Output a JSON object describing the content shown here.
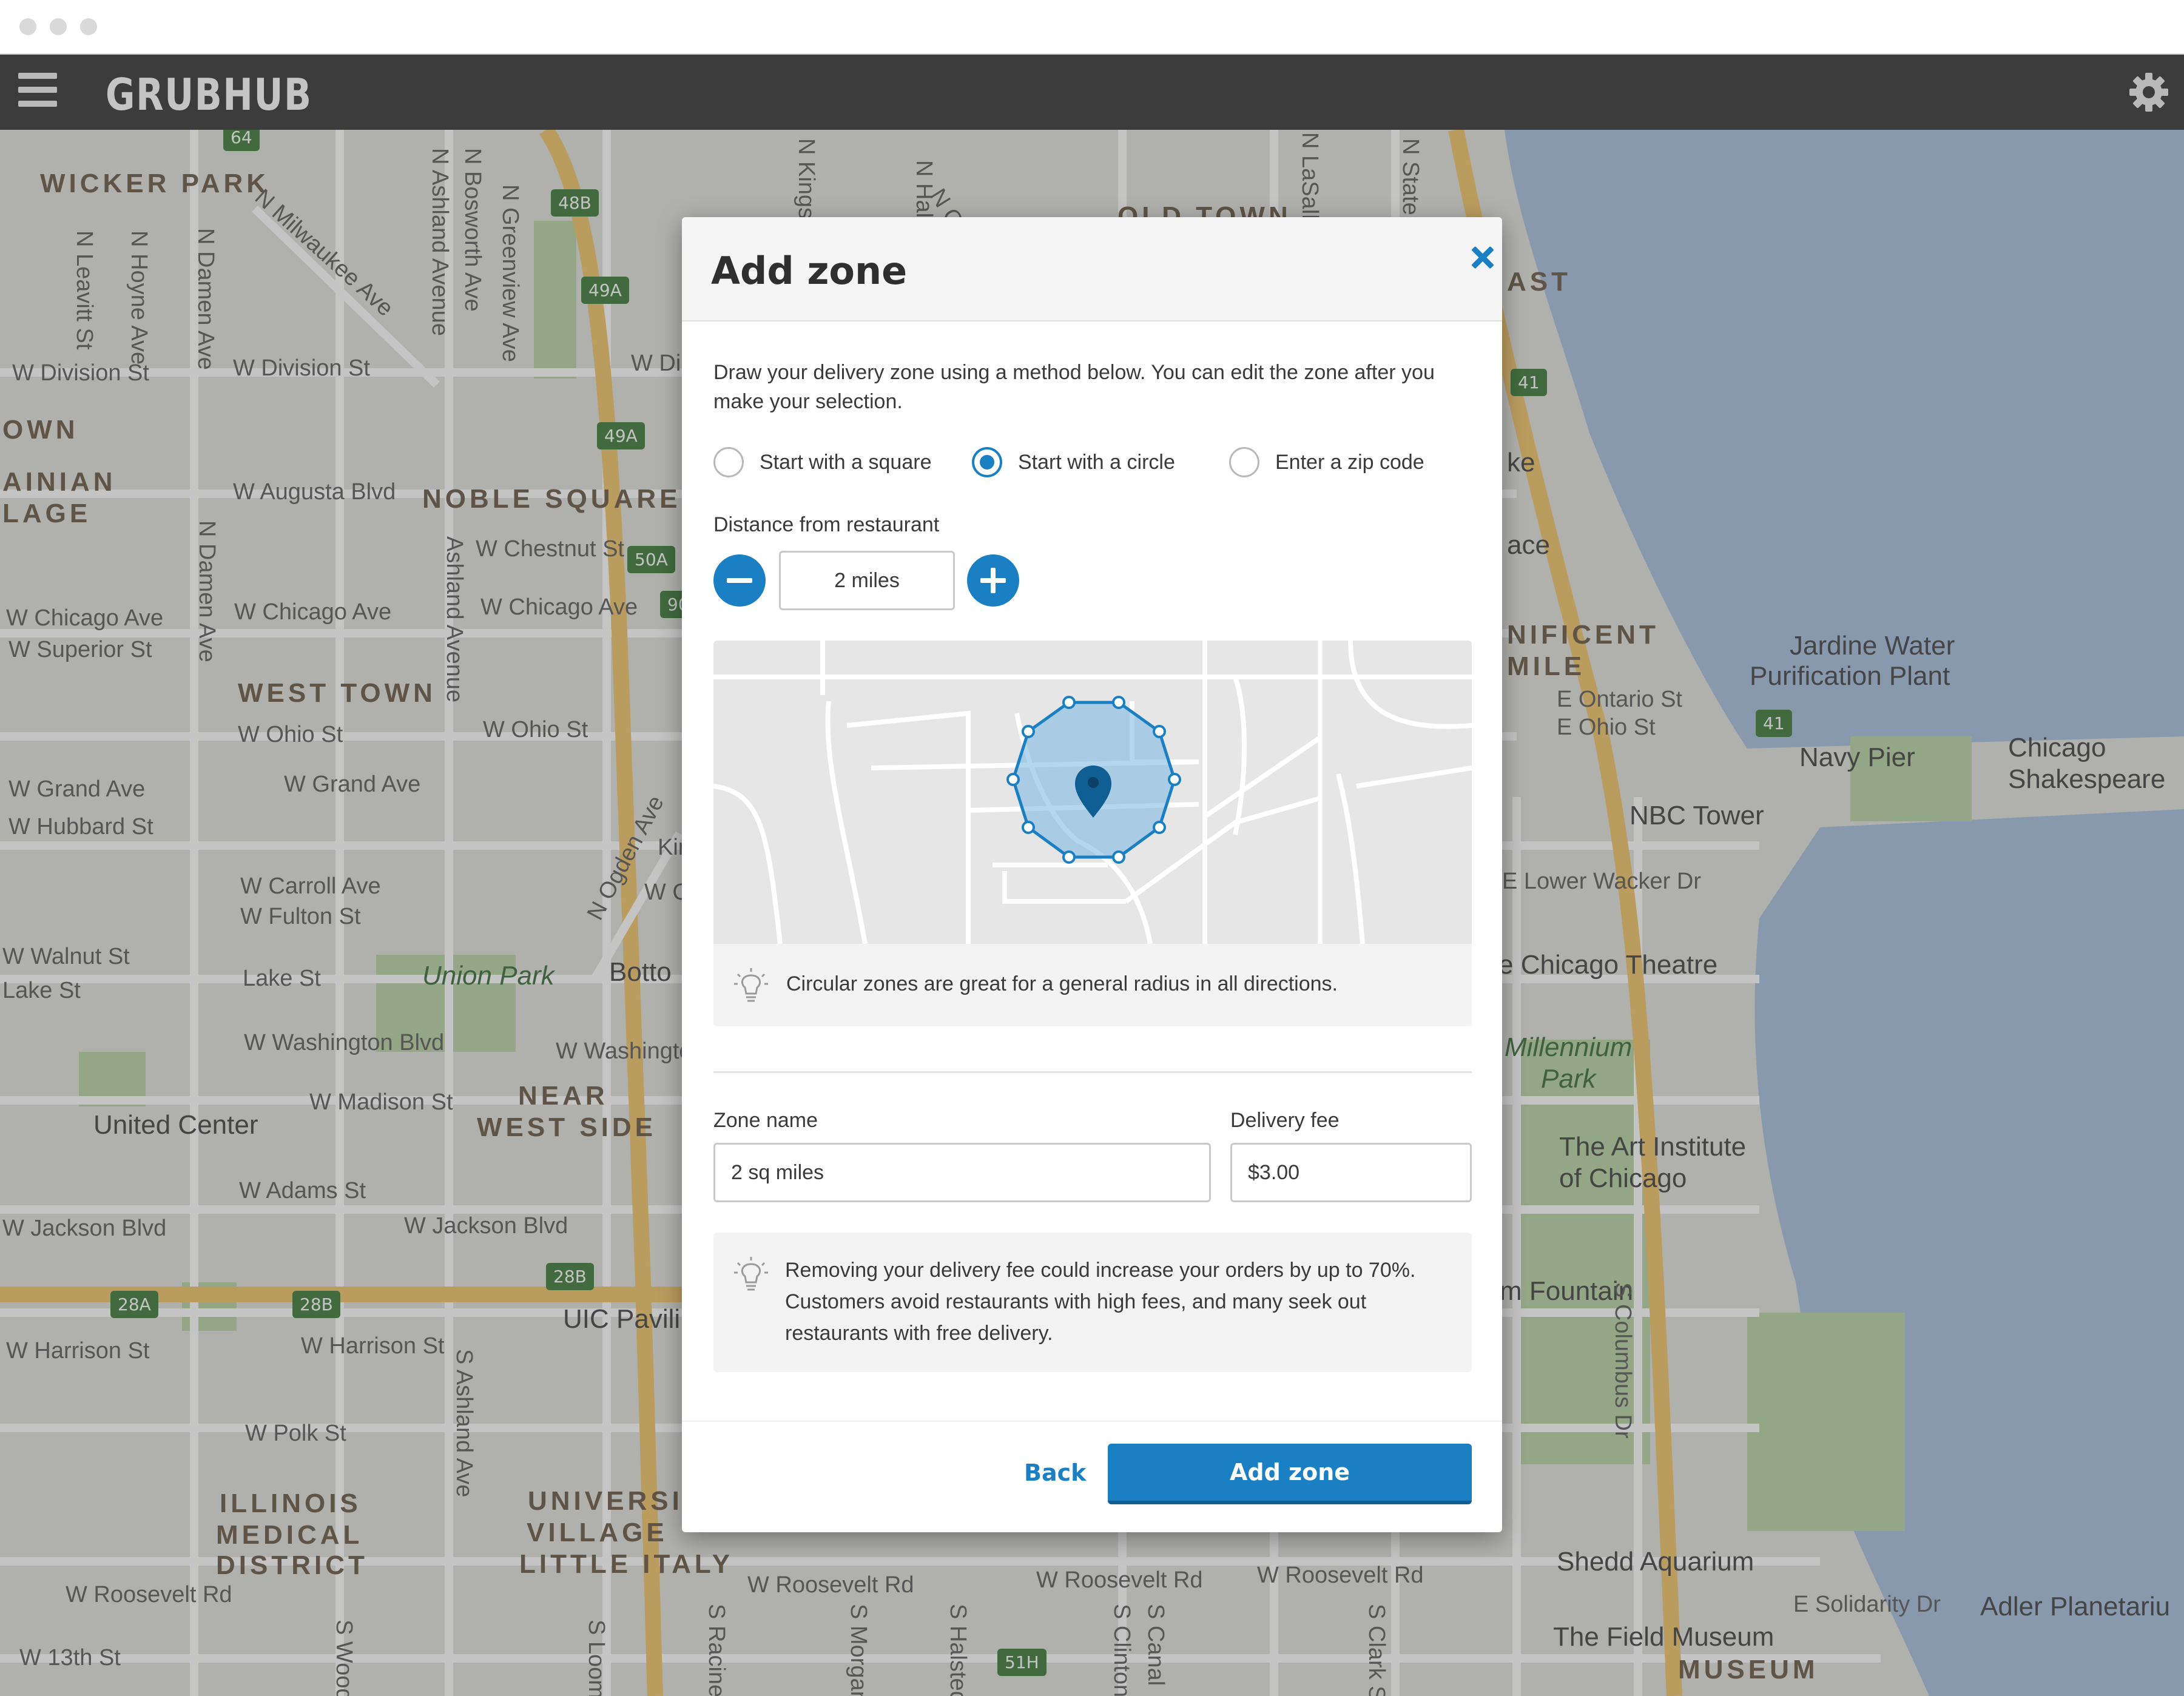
{
  "app": {
    "logo_text": "GRUBHUB"
  },
  "modal": {
    "title": "Add zone",
    "intro": "Draw your delivery zone using a method below. You can edit the zone after you make your selection.",
    "methods": [
      {
        "label": "Start with a square",
        "selected": false
      },
      {
        "label": "Start with a circle",
        "selected": true
      },
      {
        "label": "Enter a zip code",
        "selected": false
      }
    ],
    "distance": {
      "label": "Distance from restaurant",
      "value": "2 miles"
    },
    "preview_tip": "Circular zones are great for a general radius in all directions.",
    "zone_name": {
      "label": "Zone name",
      "value": "2 sq miles"
    },
    "delivery_fee": {
      "label": "Delivery fee",
      "value": "$3.00"
    },
    "fee_tip": "Removing your delivery fee could increase your orders by up to 70%. Customers avoid restaurants with high fees, and many seek out restaurants with free delivery.",
    "back_label": "Back",
    "submit_label": "Add zone"
  },
  "map": {
    "labels": [
      "WICKER PARK",
      "N Milwaukee Ave",
      "W Division St",
      "OWN",
      "AINIAN",
      "LAGE",
      "W Augusta Blvd",
      "NOBLE SQUARE",
      "W Chestnut St",
      "W Chicago Ave",
      "W Superior St",
      "WEST TOWN",
      "W Ohio St",
      "W Grand Ave",
      "W Hubbard St",
      "W Carroll Ave",
      "W Fulton St",
      "W Walnut St",
      "Lake St",
      "Union Park",
      "Botto",
      "W Washington Blvd",
      "United Center",
      "W Madison St",
      "NEAR",
      "WEST SIDE",
      "W Adams St",
      "W Jackson Blvd",
      "UIC Pavili",
      "W Harrison St",
      "W Polk St",
      "ILLINOIS",
      "MEDICAL",
      "DISTRICT",
      "UNIVERSIT",
      "VILLAGE",
      "LITTLE ITALY",
      "W Roosevelt Rd",
      "W 13th St",
      "OLD TOWN",
      "AST",
      "ke",
      "ace",
      "NIFICENT",
      "MILE",
      "E Ontario St",
      "E Ohio St",
      "Jardine Water",
      "Purification Plant",
      "Navy Pier",
      "Chicago",
      "Shakespeare",
      "NBC Tower",
      "E Lower Wacker Dr",
      "e Chicago Theatre",
      "Millennium",
      "Park",
      "The Art Institute",
      "of Chicago",
      "m Fountain",
      "S Columbus Dr",
      "Shedd Aquarium",
      "E Solidarity Dr",
      "Adler Planetariu",
      "The Field Museum",
      "MUSEUM",
      "N Ogden Ave",
      "Ashland Avenue",
      "N Damen Ave",
      "N Leavitt St",
      "N Hoyne Ave",
      "N Bosworth Ave",
      "N Greenview Ave",
      "N Ashland Avenue",
      "S Ashland Ave",
      "N LaSalle",
      "N State",
      "S Canal",
      "S Clinton",
      "S Halsted",
      "S Morgan",
      "S Racine",
      "S Loomis",
      "S Wood",
      "S Clark St",
      "Kin",
      "W C",
      "W Di",
      "N Kingsb",
      "N Hal",
      "N Cly"
    ],
    "shields": [
      "64",
      "48B",
      "49A",
      "49A",
      "50A",
      "90",
      "41",
      "41",
      "28B",
      "28A",
      "28B",
      "51H"
    ]
  }
}
